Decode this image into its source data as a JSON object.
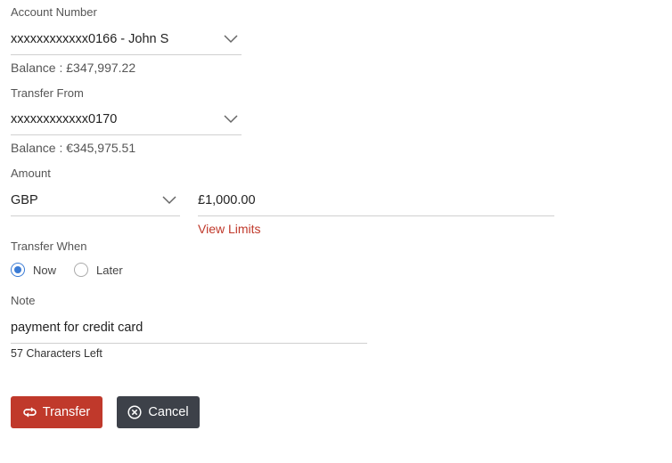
{
  "account": {
    "label": "Account Number",
    "value": "xxxxxxxxxxxx0166 - John S",
    "balance": "Balance : £347,997.22"
  },
  "transfer_from": {
    "label": "Transfer From",
    "value": "xxxxxxxxxxxx0170",
    "balance": "Balance : €345,975.51"
  },
  "amount": {
    "label": "Amount",
    "currency": "GBP",
    "value": "£1,000.00",
    "limits_link": "View Limits"
  },
  "transfer_when": {
    "label": "Transfer When",
    "options": [
      "Now",
      "Later"
    ],
    "selected": "Now"
  },
  "note": {
    "label": "Note",
    "value": "payment for credit card",
    "chars_left": "57 Characters Left"
  },
  "buttons": {
    "transfer": "Transfer",
    "cancel": "Cancel"
  },
  "colors": {
    "accent": "#c0392b",
    "dark_button": "#3d4149",
    "radio_selected": "#3a7bd5"
  }
}
